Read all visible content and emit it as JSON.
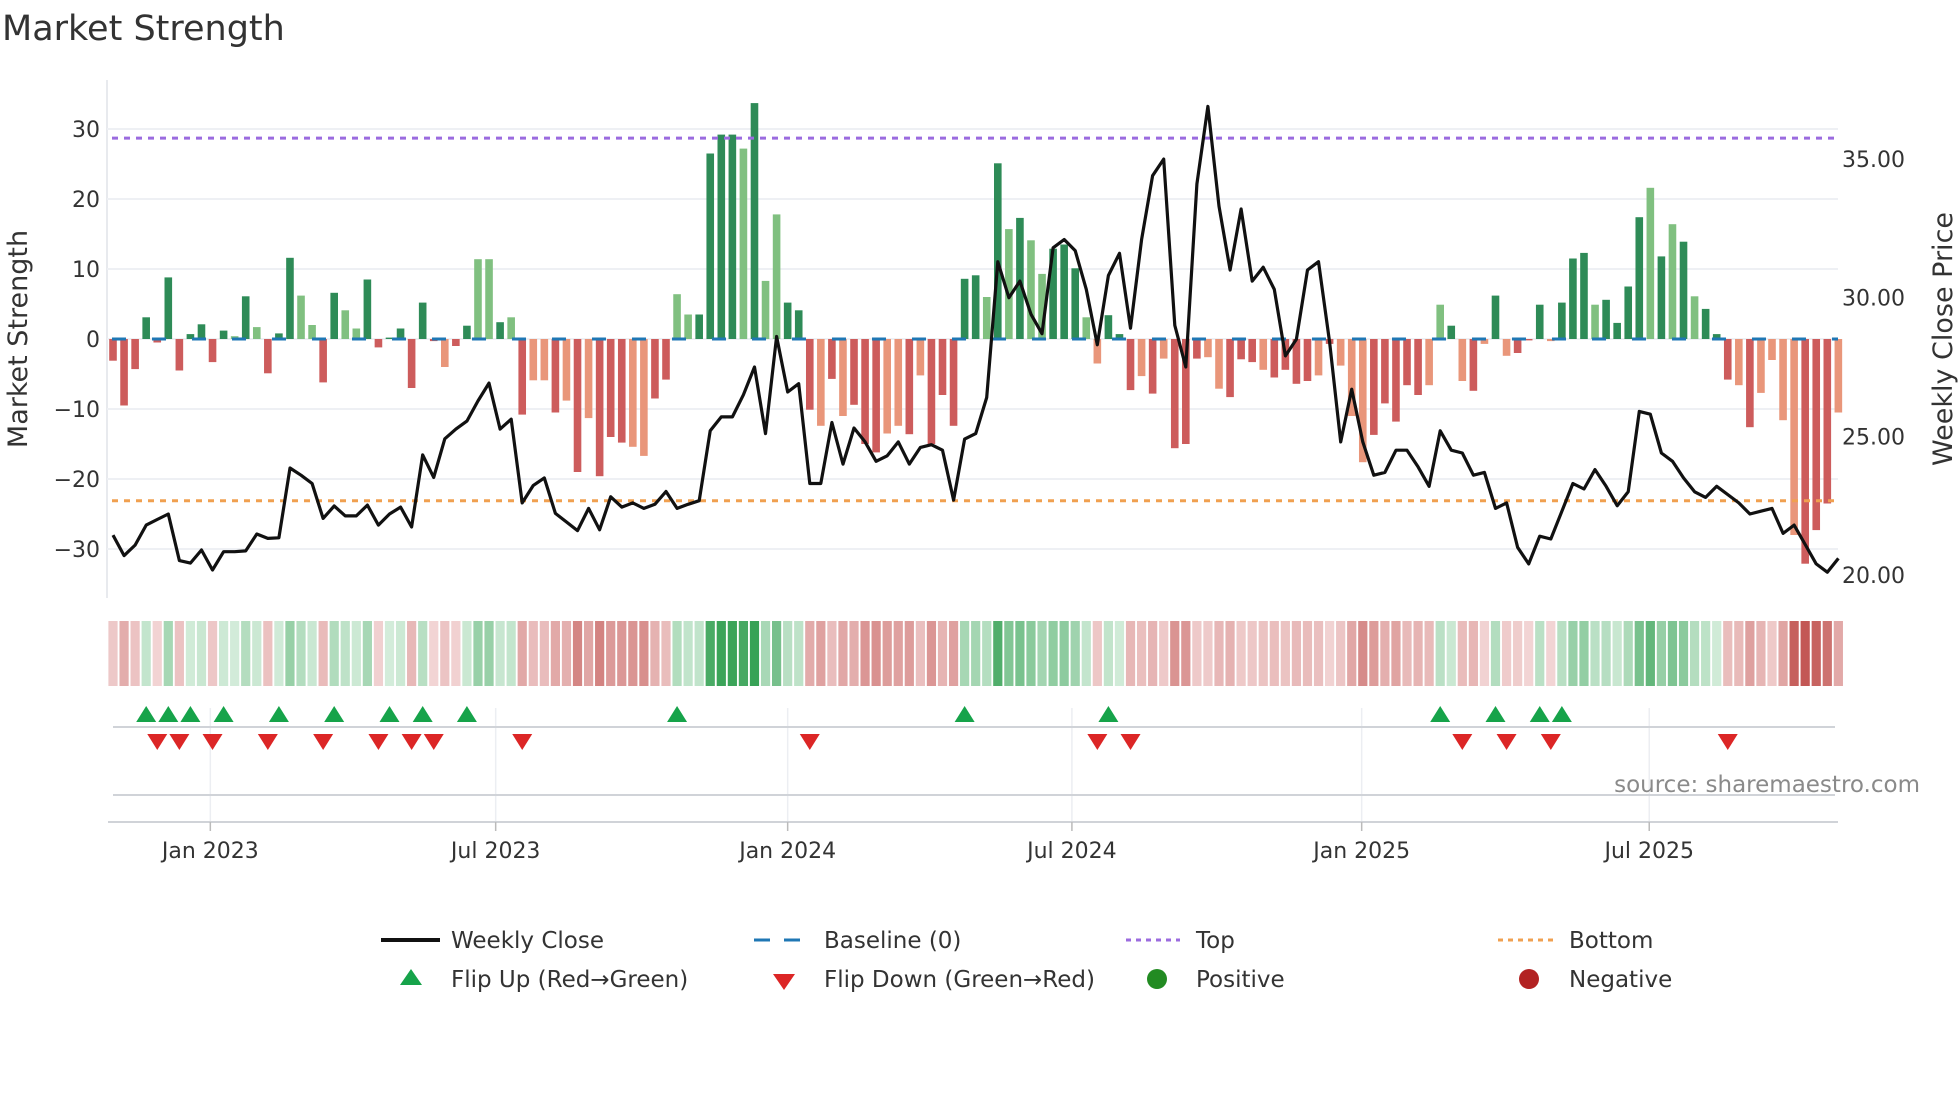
{
  "title": "Market Strength",
  "source": "source: sharemaestro.com",
  "chart_data": {
    "type": "bar",
    "title": "Market Strength",
    "ylabel": "Market Strength",
    "y2label": "Weekly Close Price",
    "ylim": [
      -37,
      37
    ],
    "y2lim": [
      19.17,
      37.85
    ],
    "yticks": [
      "30",
      "20",
      "10",
      "0",
      "−10",
      "−20",
      "−30"
    ],
    "ytick_values": [
      30,
      20,
      10,
      0,
      -10,
      -20,
      -30
    ],
    "y2ticks": [
      "35.00",
      "30.00",
      "25.00",
      "20.00"
    ],
    "y2tick_values": [
      35,
      30,
      25,
      20
    ],
    "x_ticks": [
      {
        "label": "Jan 2023",
        "week": 8.8
      },
      {
        "label": "Jul 2023",
        "week": 34.6
      },
      {
        "label": "Jan 2024",
        "week": 61.0
      },
      {
        "label": "Jul 2024",
        "week": 86.7
      },
      {
        "label": "Jan 2025",
        "week": 112.9
      },
      {
        "label": "Jul 2025",
        "week": 138.9
      }
    ],
    "top_level": 28.7,
    "bottom_level": -23.1,
    "baseline": 0,
    "strength": [
      -3.1,
      -9.5,
      -4.3,
      3.1,
      -0.5,
      8.8,
      -4.5,
      0.7,
      2.1,
      -3.3,
      1.2,
      0.4,
      6.1,
      1.7,
      -4.9,
      0.8,
      11.6,
      6.2,
      2.0,
      -6.2,
      6.6,
      4.1,
      1.5,
      8.5,
      -1.2,
      0.2,
      1.5,
      -7.0,
      5.2,
      -0.3,
      -4.0,
      -1.0,
      1.9,
      11.4,
      11.4,
      2.4,
      3.1,
      -10.8,
      -5.9,
      -5.9,
      -10.5,
      -8.8,
      -19.0,
      -11.3,
      -19.6,
      -14.0,
      -14.8,
      -15.4,
      -16.7,
      -8.5,
      -5.8,
      6.4,
      3.5,
      3.5,
      26.5,
      29.2,
      29.2,
      27.2,
      33.7,
      8.3,
      17.8,
      5.2,
      4.1,
      -10.1,
      -12.4,
      -5.7,
      -11.0,
      -9.4,
      -15.0,
      -16.2,
      -13.5,
      -12.4,
      -13.6,
      -5.2,
      -15.0,
      -8.0,
      -12.4,
      8.6,
      9.1,
      6.0,
      25.1,
      15.7,
      17.3,
      14.1,
      9.3,
      12.9,
      13.5,
      10.1,
      3.1,
      -3.5,
      3.4,
      0.7,
      -7.3,
      -5.3,
      -7.8,
      -2.8,
      -15.6,
      -15.0,
      -2.8,
      -2.6,
      -7.1,
      -8.3,
      -2.9,
      -3.3,
      -4.4,
      -5.5,
      -4.4,
      -6.4,
      -6.0,
      -5.2,
      -0.7,
      -3.8,
      -11.0,
      -17.6,
      -13.7,
      -9.2,
      -11.8,
      -6.6,
      -8.0,
      -6.6,
      4.9,
      1.9,
      -6.0,
      -7.4,
      -0.7,
      6.2,
      -2.4,
      -2.0,
      -0.2,
      4.9,
      -0.3,
      5.2,
      11.5,
      12.3,
      4.9,
      5.6,
      2.3,
      7.5,
      17.4,
      21.6,
      11.8,
      16.4,
      13.9,
      6.1,
      4.3,
      0.7,
      -5.8,
      -6.6,
      -12.6,
      -7.7,
      -3.0,
      -11.6,
      -28.0,
      -32.1,
      -27.3,
      -23.5,
      -10.5
    ],
    "shade": "dddddddddddldldddllddlldddddddlddlldldlldldldddllddllddddldlldddldldddlldldddddldldlldddlldddldldddlldddlddddldllldddddlldldldldddldddlddddldldldddldlllldddllddddll",
    "weekly_close": [
      21.44,
      20.7,
      21.08,
      21.8,
      22.0,
      22.2,
      20.52,
      20.43,
      20.9,
      20.18,
      20.84,
      20.84,
      20.87,
      21.48,
      21.32,
      21.34,
      23.86,
      23.6,
      23.3,
      22.04,
      22.49,
      22.13,
      22.13,
      22.52,
      21.8,
      22.2,
      22.45,
      21.73,
      24.33,
      23.52,
      24.91,
      25.26,
      25.55,
      26.28,
      26.92,
      25.26,
      25.62,
      22.6,
      23.23,
      23.5,
      22.22,
      21.91,
      21.6,
      22.4,
      21.63,
      22.82,
      22.45,
      22.6,
      22.4,
      22.55,
      23.01,
      22.4,
      22.55,
      22.68,
      25.2,
      25.7,
      25.7,
      26.5,
      27.5,
      25.1,
      28.6,
      26.6,
      26.9,
      23.3,
      23.3,
      25.5,
      24.0,
      25.3,
      24.8,
      24.1,
      24.3,
      24.8,
      24.0,
      24.6,
      24.7,
      24.5,
      22.7,
      24.9,
      25.1,
      26.4,
      31.3,
      30.0,
      30.6,
      29.4,
      28.7,
      31.8,
      32.1,
      31.7,
      30.3,
      28.3,
      30.8,
      31.6,
      28.9,
      32.1,
      34.4,
      35.0,
      29.0,
      27.5,
      34.1,
      36.9,
      33.3,
      31.0,
      33.2,
      30.6,
      31.1,
      30.3,
      27.9,
      28.5,
      31.0,
      31.3,
      28.4,
      24.8,
      26.7,
      24.8,
      23.6,
      23.7,
      24.5,
      24.5,
      23.9,
      23.2,
      25.2,
      24.5,
      24.4,
      23.6,
      23.7,
      22.4,
      22.6,
      21.0,
      20.4,
      21.4,
      21.3,
      22.3,
      23.3,
      23.1,
      23.8,
      23.2,
      22.5,
      23.0,
      25.9,
      25.8,
      24.4,
      24.1,
      23.5,
      23.0,
      22.8,
      23.2,
      22.9,
      22.6,
      22.2,
      22.3,
      22.4,
      21.5,
      21.8,
      21.1,
      20.4,
      20.1,
      20.6
    ],
    "colors": {
      "pos_dark": "#2e8b57",
      "pos_light": "#80c080",
      "neg_dark": "#cd5c5c",
      "neg_light": "#e9967a",
      "baseline": "#1f77b4",
      "top": "#9b6bdf",
      "bottom": "#f0a050",
      "close": "#111111",
      "flip_up": "#16a34a",
      "flip_down": "#dc2626",
      "positive": "#228b22",
      "negative": "#b22222"
    },
    "legend": {
      "placement": "bottom",
      "items": [
        "Weekly Close",
        "Baseline (0)",
        "Top",
        "Bottom",
        "Flip Up (Red→Green)",
        "Flip Down (Green→Red)",
        "Positive",
        "Negative"
      ]
    }
  }
}
